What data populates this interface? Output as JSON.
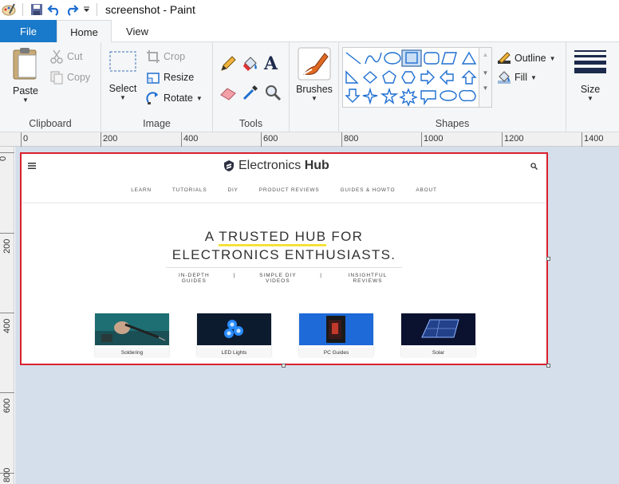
{
  "window": {
    "title": "screenshot - Paint"
  },
  "tabs": {
    "file": "File",
    "home": "Home",
    "view": "View"
  },
  "clipboard": {
    "paste": "Paste",
    "cut": "Cut",
    "copy": "Copy",
    "label": "Clipboard"
  },
  "image": {
    "select": "Select",
    "crop": "Crop",
    "resize": "Resize",
    "rotate": "Rotate",
    "label": "Image"
  },
  "tools": {
    "label": "Tools"
  },
  "brushes": {
    "label": "Brushes"
  },
  "shapes": {
    "outline": "Outline",
    "fill": "Fill",
    "label": "Shapes"
  },
  "size": {
    "label": "Size"
  },
  "ruler": {
    "h_ticks": [
      "0",
      "200",
      "400",
      "600",
      "800",
      "1000",
      "1200",
      "1400"
    ],
    "v_ticks": [
      "0",
      "200",
      "400",
      "600",
      "800"
    ]
  },
  "colors": {
    "file_tab": "#1979ca",
    "canvas_border": "#d9202e",
    "workspace": "#d5dfeb",
    "highlight": "#f5e03a"
  },
  "site": {
    "logo_light": "Electronics",
    "logo_bold": "Hub",
    "nav": [
      "LEARN",
      "TUTORIALS",
      "DIY",
      "PRODUCT REVIEWS",
      "GUIDES & HOWTO",
      "ABOUT"
    ],
    "hero_a": "A ",
    "hero_hl": "TRUSTED HUB",
    "hero_b": " FOR",
    "hero_line2": "ELECTRONICS ENTHUSIASTS.",
    "sub": [
      "IN-DEPTH GUIDES",
      "|",
      "SIMPLE DIY VIDEOS",
      "|",
      "INSIGHTFUL REVIEWS"
    ],
    "cards": [
      "Soldering",
      "LED Lights",
      "PC Guides",
      "Solar"
    ]
  }
}
